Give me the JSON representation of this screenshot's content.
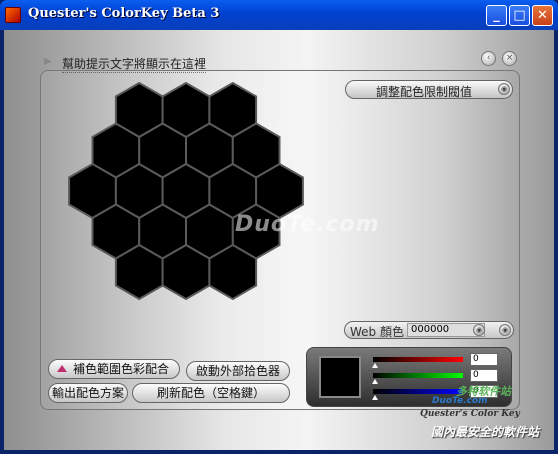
{
  "window": {
    "title": "Quester's ColorKey Beta 3",
    "minimize": "_",
    "maximize": "□",
    "close": "✕"
  },
  "help_text": "幫助提示文字將顯示在這裡",
  "nav": {
    "prev": "‹",
    "close": "×"
  },
  "limit_button": {
    "label": "調整配色限制閥值"
  },
  "hex_grid": {
    "rows": [
      3,
      4,
      5,
      4,
      3
    ],
    "color": "#000000"
  },
  "web_color": {
    "label": "Web 顏色",
    "value": "000000"
  },
  "buttons": {
    "complementary_range": "補色範圍色彩配合",
    "launch_picker": "啟動外部拾色器",
    "export_scheme": "輸出配色方案",
    "refresh_scheme": "刷新配色（空格鍵）"
  },
  "rgb": {
    "r": "0",
    "g": "0",
    "b": "0"
  },
  "watermarks": {
    "center": "DuoTe.com",
    "corner_green": "多特软件站",
    "corner_site": "DuoTe.com",
    "signature": "Quester's Color Key",
    "bottom": "國內最安全的軟件站"
  }
}
